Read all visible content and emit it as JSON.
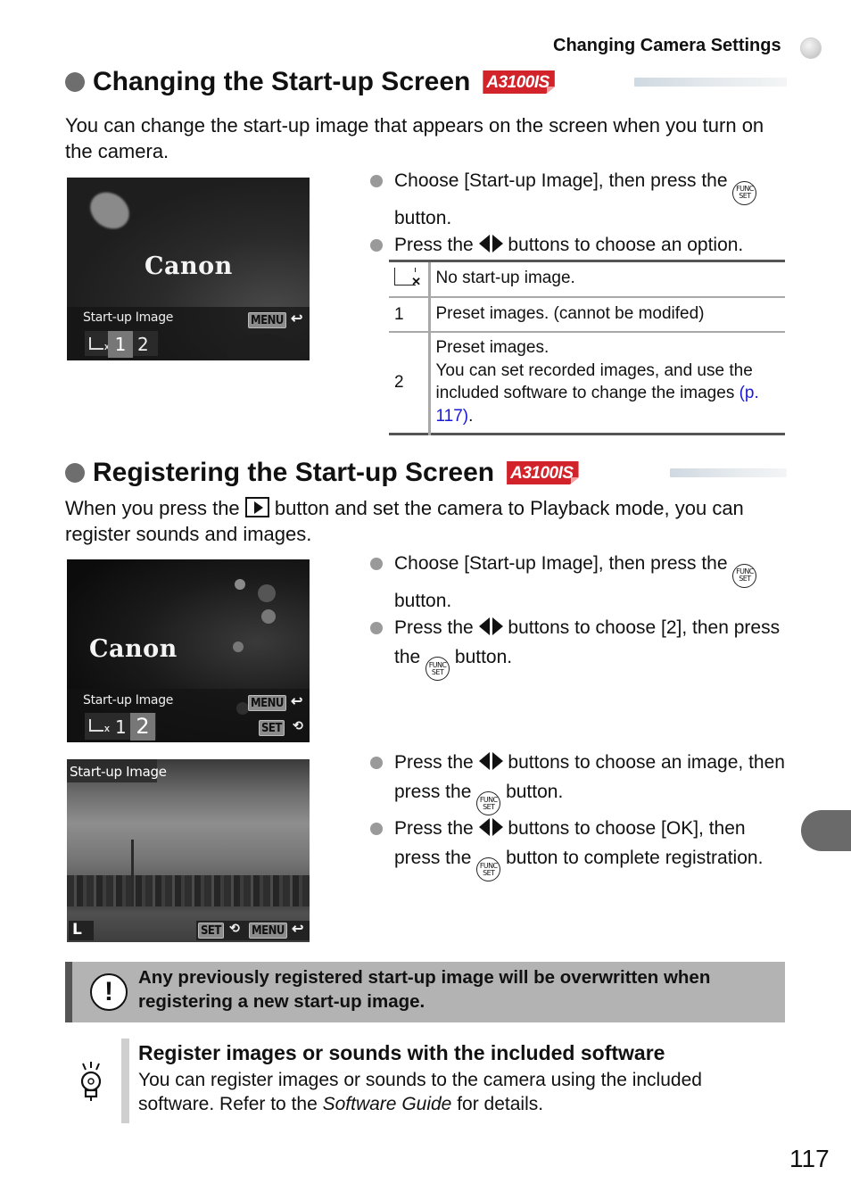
{
  "running_header": "Changing Camera Settings",
  "page_number": "117",
  "model_badge": "A3100IS",
  "section1": {
    "title": "Changing the Start-up Screen",
    "intro": "You can change the start-up image that appears on the screen when you turn on the camera.",
    "screen": {
      "logo": "Canon",
      "label": "Start-up Image",
      "menu_key": "MENU",
      "return_icon": "↩",
      "options": [
        "1",
        "2"
      ],
      "selected": "1"
    },
    "steps": [
      {
        "before": "Choose [Start-up Image], then press the",
        "icon": "func-set",
        "after": "button."
      },
      {
        "before": "Press the",
        "icon": "left-right-arrows",
        "after": "buttons to choose an option."
      }
    ],
    "table": {
      "rows": [
        {
          "key_icon": "no-start-up-image",
          "key": "",
          "lines": [
            "No start-up image."
          ]
        },
        {
          "key": "1",
          "lines": [
            "Preset images. (cannot be modifed)"
          ]
        },
        {
          "key": "2",
          "lines": [
            "Preset images.",
            "You can set recorded images, and use the included software to change the images"
          ],
          "link": "(p. 117)",
          "tail": "."
        }
      ]
    }
  },
  "section2": {
    "title": "Registering the Start-up Screen",
    "intro_before": "When you press the",
    "intro_icon": "playback",
    "intro_after": "button and set the camera to Playback mode, you can register sounds and images.",
    "screen1": {
      "logo": "Canon",
      "label": "Start-up Image",
      "menu_key": "MENU",
      "set_key": "SET",
      "options": [
        "1",
        "2"
      ],
      "selected": "2"
    },
    "screen2": {
      "label": "Start-up Image",
      "size_label": "L",
      "set_key": "SET",
      "menu_key": "MENU"
    },
    "steps_a": [
      {
        "before": "Choose [Start-up Image], then press the",
        "icon": "func-set",
        "after": "button."
      },
      {
        "before": "Press the",
        "icon": "left-right-arrows",
        "middle": "buttons to choose [2], then press the",
        "icon2": "func-set",
        "after": "button."
      }
    ],
    "steps_b": [
      {
        "before": "Press the",
        "icon": "left-right-arrows",
        "middle": "buttons to choose an image, then press the",
        "icon2": "func-set",
        "after": "button."
      },
      {
        "before": "Press the",
        "icon": "left-right-arrows",
        "middle": "buttons to choose [OK], then press the",
        "icon2": "func-set",
        "after": "button to complete registration."
      }
    ]
  },
  "func_icon": {
    "top": "FUNC",
    "bottom": "SET"
  },
  "caution": {
    "icon": "caution-icon",
    "text": "Any previously registered start-up image will be overwritten when registering a new start-up image."
  },
  "tip": {
    "icon": "lightbulb-icon",
    "title": "Register images or sounds with the included software",
    "text_before": "You can register images or sounds to the camera using the included software. Refer to the ",
    "text_italic": "Software Guide",
    "text_after": " for details."
  },
  "colors": {
    "badge_red": "#d2232a",
    "link_blue": "#1a1ad6",
    "caution_bg": "#b3b3b3",
    "side_tab": "#6a6a6a"
  }
}
